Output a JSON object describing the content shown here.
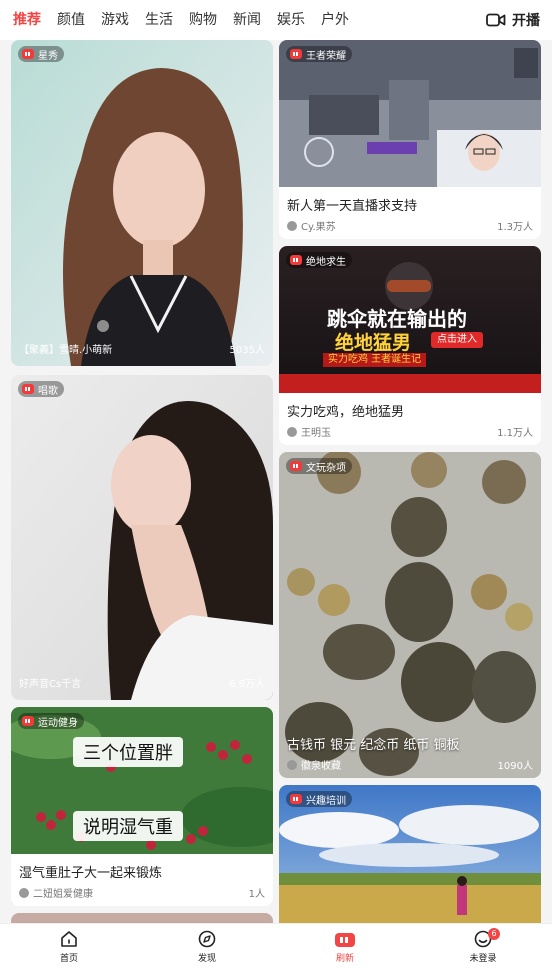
{
  "nav": {
    "tabs": [
      {
        "label": "推荐"
      },
      {
        "label": "颜值"
      },
      {
        "label": "游戏"
      },
      {
        "label": "生活"
      },
      {
        "label": "购物"
      },
      {
        "label": "新闻"
      },
      {
        "label": "娱乐"
      },
      {
        "label": "户外"
      }
    ],
    "active_tab": "推荐",
    "start_live_label": "开播",
    "start_live_icon": "video-camera-icon"
  },
  "cards": {
    "c1": {
      "badge": "星秀",
      "streamer": "【聚義】雪晴.小萌新",
      "viewers": "5035人"
    },
    "c2": {
      "badge": "王者荣耀",
      "title": "新人第一天直播求支持",
      "streamer": "Cy.果苏",
      "viewers": "1.3万人"
    },
    "c3": {
      "badge": "绝地求生",
      "banner_title": "跳伞就在输出的",
      "banner_sub": "绝地猛男",
      "banner_btn": "点击进入",
      "banner_tag": "实力吃鸡 王者诞生记",
      "title": "实力吃鸡，绝地猛男",
      "streamer": "王明玉",
      "viewers": "1.1万人"
    },
    "c4": {
      "badge": "唱歌",
      "streamer": "好声音Cs千言",
      "viewers": "6.9万人"
    },
    "c5": {
      "badge": "文玩杂项",
      "caption": "古钱币 银元 纪念币 纸币 铜板",
      "streamer": "徽泉收藏",
      "viewers": "1090人"
    },
    "c6": {
      "badge": "运动健身",
      "overlay1": "三个位置胖",
      "overlay2": "说明湿气重",
      "title": "湿气重肚子大一起来锻炼",
      "streamer": "二妞姐爱健康",
      "viewers": "1人"
    },
    "c7": {
      "badge": "兴趣培训"
    }
  },
  "bottom": {
    "items": [
      {
        "label": "首页",
        "icon": "home-icon"
      },
      {
        "label": "发现",
        "icon": "compass-icon"
      },
      {
        "label": "刷新",
        "icon": "live-tv-icon"
      },
      {
        "label": "未登录",
        "icon": "smile-face-icon"
      }
    ],
    "active": "刷新",
    "badge_count": "6"
  },
  "colors": {
    "accent": "#f24545"
  }
}
